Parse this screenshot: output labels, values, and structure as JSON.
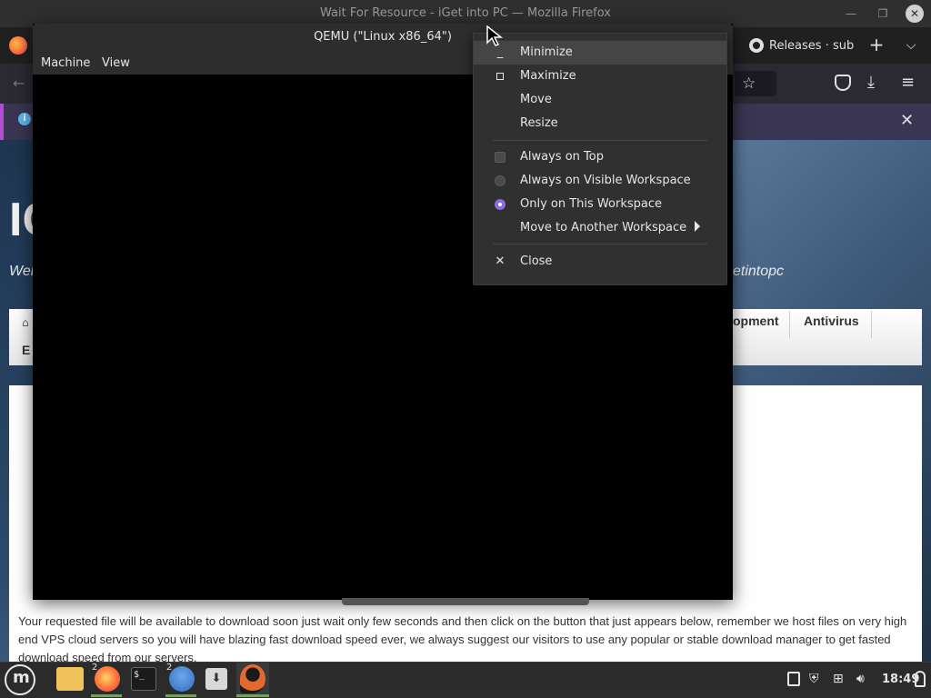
{
  "firefox": {
    "window_title": "Wait For Resource - iGet into PC — Mozilla Firefox",
    "tab_releases": "Releases · sub",
    "notification_close": "✕"
  },
  "website": {
    "title": "IG",
    "tagline_left": "Wel",
    "tagline_right": "etintopc",
    "nav_development": "opment",
    "nav_antivirus": "Antivirus",
    "nav_row2": "E",
    "content_text": "Your requested file will be available to download soon just wait only few seconds and then click on the button that just appears below, remember we host files on very high end VPS cloud servers so you will have blazing fast download speed ever, we always suggest our visitors to use any popular or stable download manager to get fasted download speed from our servers."
  },
  "qemu": {
    "title": "QEMU (\"Linux x86_64\")",
    "menu_machine": "Machine",
    "menu_view": "View"
  },
  "context_menu": {
    "minimize": "Minimize",
    "maximize": "Maximize",
    "move": "Move",
    "resize": "Resize",
    "always_on_top": "Always on Top",
    "always_on_visible_workspace": "Always on Visible Workspace",
    "only_on_this_workspace": "Only on This Workspace",
    "move_to_another_workspace": "Move to Another Workspace",
    "close": "Close"
  },
  "taskbar": {
    "firefox_badge": "2",
    "globe_badge": "2",
    "terminal_prompt": "$_",
    "clock": "18:49"
  },
  "colors": {
    "accent_radio": "#8a6de0",
    "notification_bar": "#3a3552"
  }
}
